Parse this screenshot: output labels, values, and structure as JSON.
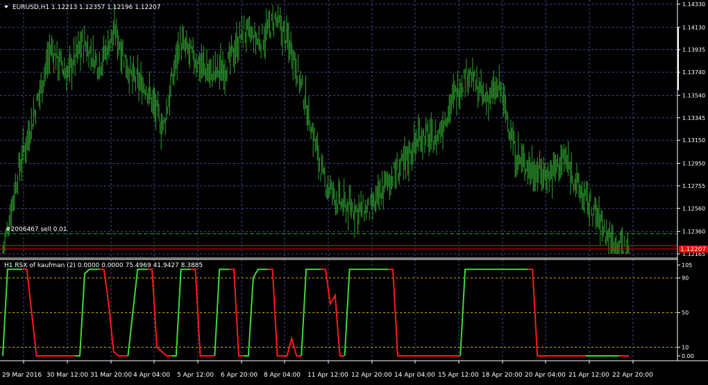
{
  "main_chart": {
    "header": "EURUSD,H1  1.12213 1.12357 1.12196 1.12207",
    "order_label": "#2006467 sell 0.01",
    "current_price_label": "1.12207",
    "price_ticks": [
      "1.14330",
      "1.14130",
      "1.13935",
      "1.13740",
      "1.13540",
      "1.13345",
      "1.13150",
      "1.12950",
      "1.12755",
      "1.12560",
      "1.12360",
      "1.12165"
    ],
    "order_line_price": 1.1234,
    "bid_line_price": 1.12207
  },
  "indicator": {
    "header": "H1  RSX of kaufman (2) 0.0000 0.0000 75.4969 41.9427 8.3885",
    "level_ticks": [
      "105",
      "90",
      "50",
      "10",
      "0.00"
    ]
  },
  "time_axis": {
    "labels": [
      "29 Mar 2016",
      "30 Mar 12:00",
      "31 Mar 20:00",
      "4 Apr 04:00",
      "5 Apr 12:00",
      "6 Apr 20:00",
      "8 Apr 04:00",
      "11 Apr 12:00",
      "12 Apr 20:00",
      "14 Apr 04:00",
      "15 Apr 12:00",
      "18 Apr 20:00",
      "20 Apr 04:00",
      "21 Apr 12:00",
      "22 Apr 20:00"
    ]
  },
  "colors": {
    "background": "#000000",
    "grid": "#3b4a8a",
    "candle": "#2fa32f",
    "rsx_up": "#3cdc3c",
    "rsx_down": "#ff1a1a",
    "order_line": "#2fa32f",
    "bid_line": "#ff0000",
    "level_line": "#c8b400",
    "text": "#ffffff"
  },
  "chart_data": {
    "type": "line",
    "x_labels": [
      "29 Mar 2016",
      "30 Mar 12:00",
      "31 Mar 20:00",
      "4 Apr 04:00",
      "5 Apr 12:00",
      "6 Apr 20:00",
      "8 Apr 04:00",
      "11 Apr 12:00",
      "12 Apr 20:00",
      "14 Apr 04:00",
      "15 Apr 12:00",
      "18 Apr 20:00",
      "20 Apr 04:00",
      "21 Apr 12:00",
      "22 Apr 20:00"
    ],
    "series": [
      {
        "name": "EURUSD,H1",
        "values": [
          1.1217,
          1.129,
          1.134,
          1.1395,
          1.1372,
          1.14,
          1.138,
          1.141,
          1.137,
          1.136,
          1.1325,
          1.14,
          1.1385,
          1.1372,
          1.138,
          1.141,
          1.14,
          1.142,
          1.1395,
          1.134,
          1.128,
          1.126,
          1.1255,
          1.1255,
          1.128,
          1.1295,
          1.132,
          1.1315,
          1.135,
          1.1375,
          1.135,
          1.136,
          1.13,
          1.129,
          1.1285,
          1.13,
          1.127,
          1.125,
          1.1225,
          1.122
        ]
      }
    ],
    "ylim": [
      1.12165,
      1.1433
    ],
    "indicator": {
      "name": "RSX of kaufman (2)",
      "ylim": [
        0,
        105
      ],
      "levels": [
        10,
        50,
        90
      ],
      "segments": [
        {
          "color": "up",
          "values": [
            0,
            100,
            100,
            100,
            100
          ]
        },
        {
          "color": "down",
          "values": [
            100,
            100,
            50,
            0,
            0,
            0,
            0,
            0,
            0,
            0,
            0,
            0
          ]
        },
        {
          "color": "up",
          "values": [
            0,
            0,
            95,
            100,
            100,
            100
          ]
        },
        {
          "color": "down",
          "values": [
            100,
            100,
            60,
            5,
            0,
            0,
            0
          ]
        },
        {
          "color": "up",
          "values": [
            0,
            50,
            100,
            100,
            100
          ]
        },
        {
          "color": "down",
          "values": [
            100,
            100,
            10,
            5,
            0,
            0
          ]
        },
        {
          "color": "up",
          "values": [
            0,
            0,
            100,
            100,
            100
          ]
        },
        {
          "color": "down",
          "values": [
            100,
            100,
            0,
            0,
            0,
            0
          ]
        },
        {
          "color": "up",
          "values": [
            0,
            100,
            100,
            100
          ]
        },
        {
          "color": "down",
          "values": [
            100,
            100,
            0,
            0
          ]
        },
        {
          "color": "up",
          "values": [
            0,
            0,
            90,
            100,
            100,
            100
          ]
        },
        {
          "color": "down",
          "values": [
            100,
            100,
            0,
            0,
            0,
            20,
            0,
            0
          ]
        },
        {
          "color": "up",
          "values": [
            0,
            100,
            100,
            100,
            100
          ]
        },
        {
          "color": "down",
          "values": [
            100,
            100,
            60,
            70,
            0,
            0
          ]
        },
        {
          "color": "up",
          "values": [
            0,
            100,
            100,
            100,
            100,
            100,
            100,
            100,
            100,
            100
          ]
        },
        {
          "color": "down",
          "values": [
            100,
            100,
            0,
            0,
            0,
            0,
            0,
            0,
            0,
            0,
            0,
            0,
            0,
            0,
            0,
            0
          ]
        },
        {
          "color": "up",
          "values": [
            0,
            100,
            100,
            100,
            100,
            100,
            100,
            100,
            100,
            100,
            100,
            100,
            100,
            100,
            100
          ]
        },
        {
          "color": "down",
          "values": [
            100,
            100,
            0,
            0,
            0,
            0,
            0,
            0,
            0,
            0,
            0,
            0,
            0
          ]
        },
        {
          "color": "up",
          "values": [
            0,
            0,
            0,
            0,
            0,
            0,
            0,
            0
          ]
        },
        {
          "color": "down",
          "values": [
            0,
            0,
            0
          ]
        }
      ]
    }
  }
}
